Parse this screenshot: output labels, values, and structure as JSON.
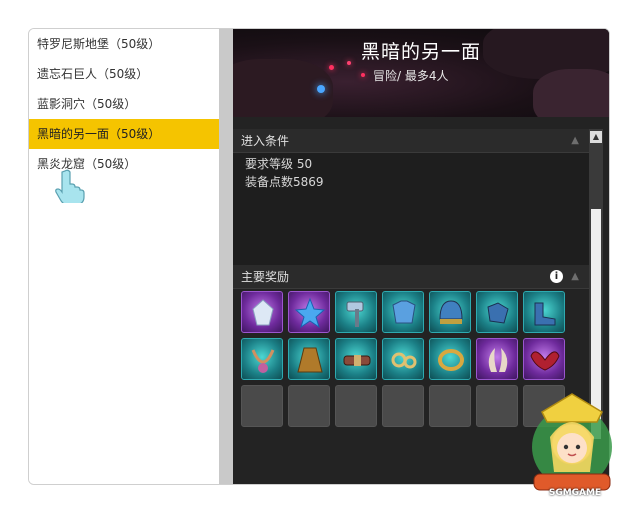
{
  "dungeon_list": {
    "items": [
      {
        "label": "特罗尼斯地堡（50级）",
        "selected": false
      },
      {
        "label": "遗忘石巨人（50级）",
        "selected": false
      },
      {
        "label": "蓝影洞穴（50级）",
        "selected": false
      },
      {
        "label": "黑暗的另一面（50级）",
        "selected": true
      },
      {
        "label": "黑炎龙窟（50级）",
        "selected": false
      }
    ]
  },
  "banner": {
    "title": "黑暗的另一面",
    "subtitle": "冒险/ 最多4人"
  },
  "requirements": {
    "header": "进入条件",
    "level": "要求等级 50",
    "gear_score": "装备点数5869"
  },
  "rewards": {
    "header": "主要奖励",
    "items": [
      {
        "icon": "crystal-shard-icon",
        "rarity": "purple"
      },
      {
        "icon": "blue-star-icon",
        "rarity": "purple"
      },
      {
        "icon": "hammer-icon",
        "rarity": "teal"
      },
      {
        "icon": "cloth-armor-icon",
        "rarity": "teal"
      },
      {
        "icon": "helmet-icon",
        "rarity": "teal"
      },
      {
        "icon": "gloves-icon",
        "rarity": "teal"
      },
      {
        "icon": "boots-icon",
        "rarity": "teal"
      },
      {
        "icon": "necklace-icon",
        "rarity": "teal"
      },
      {
        "icon": "cape-icon",
        "rarity": "teal"
      },
      {
        "icon": "belt-icon",
        "rarity": "teal"
      },
      {
        "icon": "earrings-icon",
        "rarity": "teal"
      },
      {
        "icon": "ring-icon",
        "rarity": "teal"
      },
      {
        "icon": "horns-icon",
        "rarity": "purple"
      },
      {
        "icon": "wings-icon",
        "rarity": "purple"
      }
    ],
    "empty_slots": 7
  },
  "watermark": {
    "text": "SGMGAME"
  },
  "colors": {
    "selected": "#f5c400",
    "panel_bg": "#232323",
    "purple_slot": "#6e2a9c",
    "teal_slot": "#1b7f86"
  }
}
